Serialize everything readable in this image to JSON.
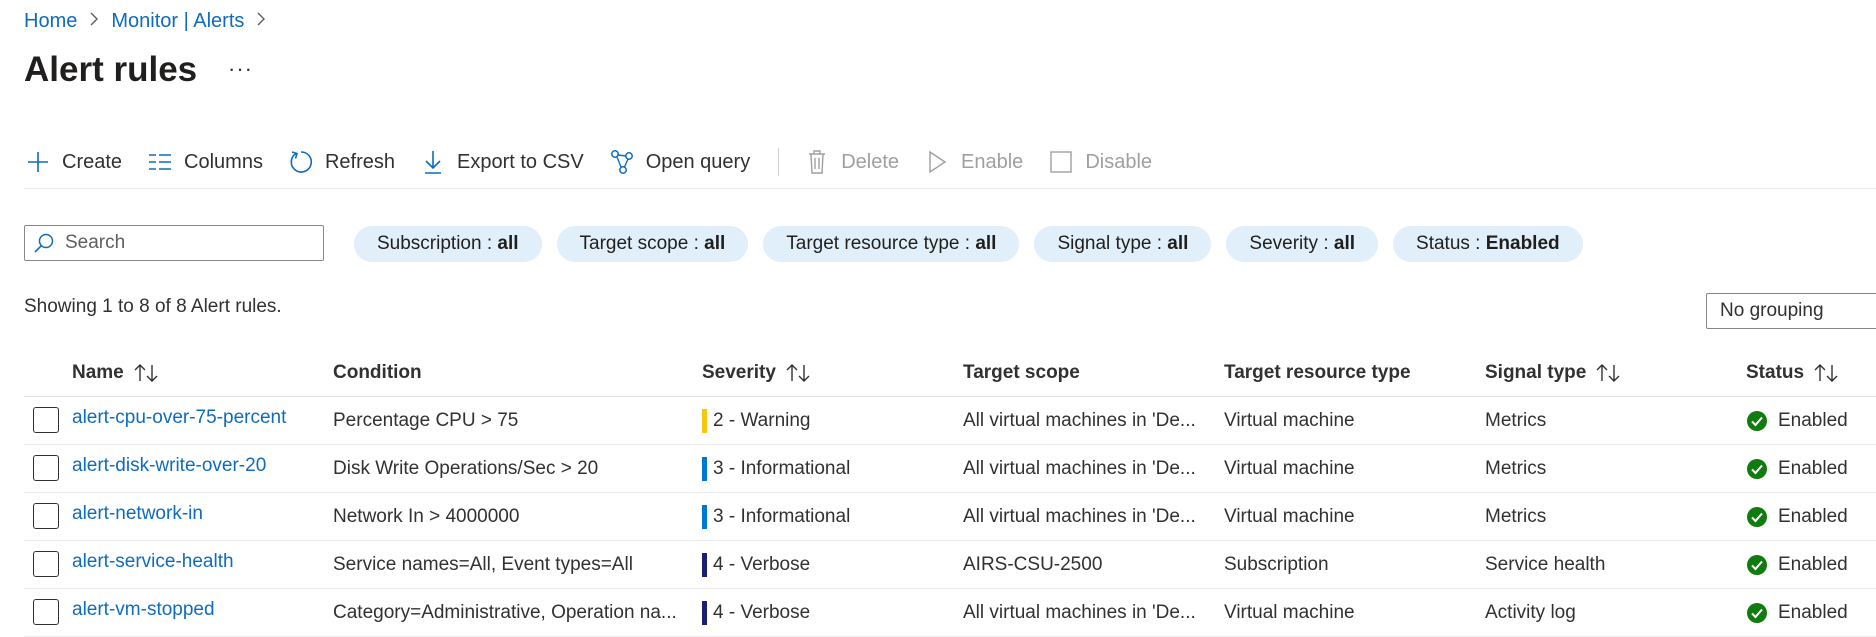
{
  "breadcrumb": [
    {
      "label": "Home"
    },
    {
      "label": "Monitor | Alerts"
    }
  ],
  "page": {
    "title": "Alert rules",
    "more_label": "···"
  },
  "toolbar": {
    "create": "Create",
    "columns": "Columns",
    "refresh": "Refresh",
    "export": "Export to CSV",
    "open_query": "Open query",
    "delete": "Delete",
    "enable": "Enable",
    "disable": "Disable"
  },
  "search": {
    "placeholder": "Search",
    "value": ""
  },
  "filters": [
    {
      "label": "Subscription : ",
      "value": "all"
    },
    {
      "label": "Target scope : ",
      "value": "all"
    },
    {
      "label": "Target resource type : ",
      "value": "all"
    },
    {
      "label": "Signal type : ",
      "value": "all"
    },
    {
      "label": "Severity : ",
      "value": "all"
    },
    {
      "label": "Status : ",
      "value": "Enabled"
    }
  ],
  "summary": "Showing 1 to 8 of 8 Alert rules.",
  "grouping": {
    "selected": "No grouping"
  },
  "columns": {
    "name": "Name",
    "condition": "Condition",
    "severity": "Severity",
    "target_scope": "Target scope",
    "target_resource_type": "Target resource type",
    "signal_type": "Signal type",
    "status": "Status"
  },
  "colors": {
    "link": "#0f6cbd",
    "pill_bg": "#e1effa",
    "sev_warning": "#f2c811",
    "sev_informational": "#0078d4",
    "sev_verbose": "#1a1f71",
    "status_enabled": "#107c10"
  },
  "rows": [
    {
      "name": "alert-cpu-over-75-percent",
      "condition": "Percentage CPU > 75",
      "severity": "2 - Warning",
      "severity_color": "#f2c811",
      "target_scope": "All virtual machines in 'De...",
      "target_resource_type": "Virtual machine",
      "signal_type": "Metrics",
      "status": "Enabled"
    },
    {
      "name": "alert-disk-write-over-20",
      "condition": "Disk Write Operations/Sec > 20",
      "severity": "3 - Informational",
      "severity_color": "#0078d4",
      "target_scope": "All virtual machines in 'De...",
      "target_resource_type": "Virtual machine",
      "signal_type": "Metrics",
      "status": "Enabled"
    },
    {
      "name": "alert-network-in",
      "condition": "Network In > 4000000",
      "severity": "3 - Informational",
      "severity_color": "#0078d4",
      "target_scope": "All virtual machines in 'De...",
      "target_resource_type": "Virtual machine",
      "signal_type": "Metrics",
      "status": "Enabled"
    },
    {
      "name": "alert-service-health",
      "condition": "Service names=All, Event types=All",
      "severity": "4 - Verbose",
      "severity_color": "#1a1f71",
      "target_scope": "AIRS-CSU-2500",
      "target_resource_type": "Subscription",
      "signal_type": "Service health",
      "status": "Enabled"
    },
    {
      "name": "alert-vm-stopped",
      "condition": "Category=Administrative, Operation na...",
      "severity": "4 - Verbose",
      "severity_color": "#1a1f71",
      "target_scope": "All virtual machines in 'De...",
      "target_resource_type": "Virtual machine",
      "signal_type": "Activity log",
      "status": "Enabled"
    }
  ]
}
